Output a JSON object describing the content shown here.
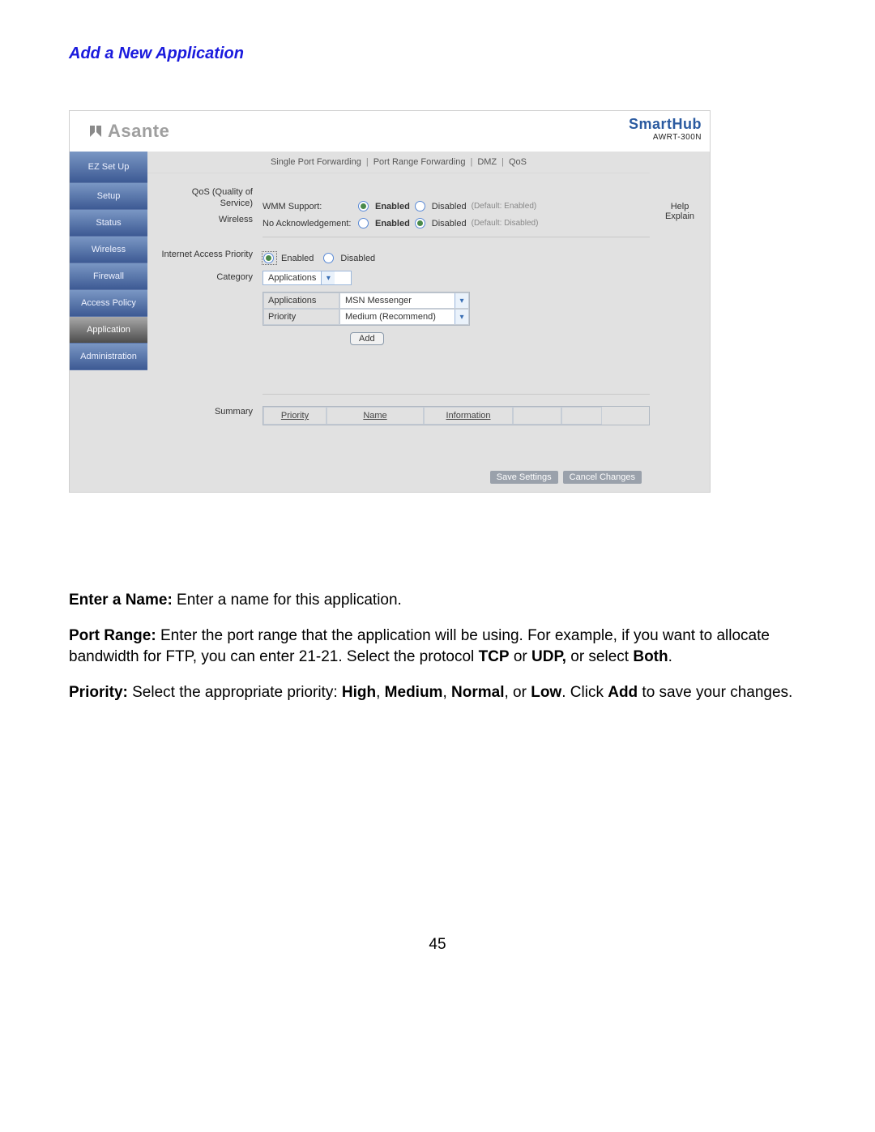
{
  "doc_heading": "Add a New Application",
  "brand": {
    "name": "Asante",
    "product": "SmartHub",
    "model": "AWRT-300N"
  },
  "sidebar": {
    "items": [
      {
        "label": "EZ Set Up",
        "active": false
      },
      {
        "label": "Setup",
        "active": false
      },
      {
        "label": "Status",
        "active": false
      },
      {
        "label": "Wireless",
        "active": false
      },
      {
        "label": "Firewall",
        "active": false
      },
      {
        "label": "Access Policy",
        "active": false
      },
      {
        "label": "Application",
        "active": true
      },
      {
        "label": "Administration",
        "active": false
      }
    ]
  },
  "subnav": {
    "items": [
      "Single Port Forwarding",
      "Port Range Forwarding",
      "DMZ",
      "QoS"
    ]
  },
  "qos": {
    "section_label_1": "QoS (Quality of",
    "section_label_2": "Service)",
    "section_label_3": "Wireless",
    "wmm_label": "WMM Support:",
    "wmm_enabled": "Enabled",
    "wmm_disabled": "Disabled",
    "wmm_default": "(Default: Enabled)",
    "noack_label": "No Acknowledgement:",
    "noack_enabled": "Enabled",
    "noack_disabled": "Disabled",
    "noack_default": "(Default: Disabled)"
  },
  "iap": {
    "section_label": "Internet Access Priority",
    "enabled_label": "Enabled",
    "disabled_label": "Disabled",
    "category_label": "Category",
    "category_value": "Applications",
    "app_field_label": "Applications",
    "app_field_value": "MSN Messenger",
    "priority_field_label": "Priority",
    "priority_field_value": "Medium (Recommend)",
    "add_button": "Add"
  },
  "summary": {
    "label": "Summary",
    "cols": [
      "Priority",
      "Name",
      "Information",
      "",
      ""
    ]
  },
  "actions": {
    "save": "Save Settings",
    "cancel": "Cancel Changes"
  },
  "help": {
    "line1": "Help",
    "line2": "Explain"
  },
  "instructions": {
    "p1_label": "Enter a Name:",
    "p1_rest": " Enter a name for this application.",
    "p2_label": "Port Range:",
    "p2_rest_a": " Enter the port range that the application will be using. For example, if you want to allocate bandwidth for FTP, you can enter 21-21. Select the protocol ",
    "p2_tcp": "TCP",
    "p2_or": " or ",
    "p2_udp": "UDP,",
    "p2_rest_b": " or select ",
    "p2_both": "Both",
    "p2_end": ".",
    "p3_label": "Priority:",
    "p3_rest_a": " Select the appropriate priority: ",
    "p3_high": "High",
    "p3_c1": ", ",
    "p3_medium": "Medium",
    "p3_c2": ", ",
    "p3_normal": "Normal",
    "p3_c3": ", or ",
    "p3_low": "Low",
    "p3_rest_b": ". Click ",
    "p3_add": "Add",
    "p3_end": " to save your changes."
  },
  "page_number": "45"
}
